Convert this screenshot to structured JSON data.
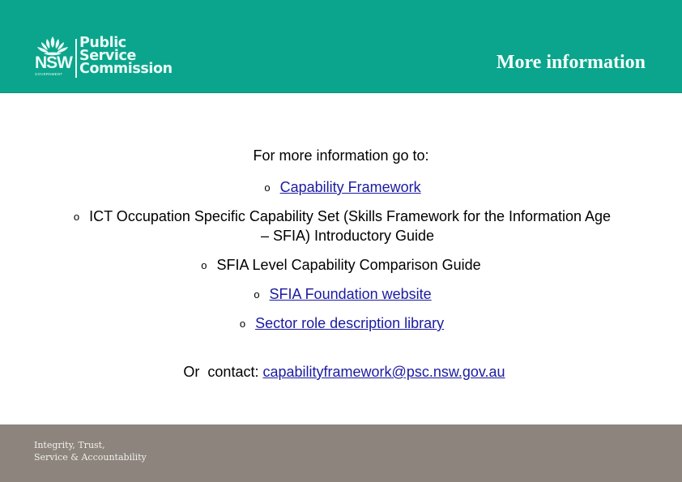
{
  "header": {
    "logo": {
      "emblem_icon": "waratah-icon",
      "state": "NSW",
      "government": "GOVERNMENT",
      "org_lines": [
        "Public",
        "Service",
        "Commission"
      ]
    },
    "title": "More information",
    "background_color": "#0aa58c"
  },
  "content": {
    "intro": "For more information go to:",
    "bullet_glyph": "o",
    "items": [
      {
        "text": "Capability Framework",
        "is_link": true
      },
      {
        "text_line1": "ICT Occupation Specific Capability Set (Skills Framework for the Information Age",
        "text_line2": "– SFIA) Introductory Guide",
        "is_link": false
      },
      {
        "text": "SFIA Level Capability Comparison Guide",
        "is_link": false
      },
      {
        "text": "SFIA Foundation website",
        "is_link": true
      },
      {
        "text": "Sector role description library",
        "is_link": true
      }
    ],
    "contact_label": "Or  contact:",
    "contact_email": "capabilityframework@psc.nsw.gov.au",
    "link_color": "#1b1ba0"
  },
  "footer": {
    "tagline_line1": "Integrity, Trust,",
    "tagline_line2": "Service & Accountability",
    "background_color": "#8c847d"
  }
}
